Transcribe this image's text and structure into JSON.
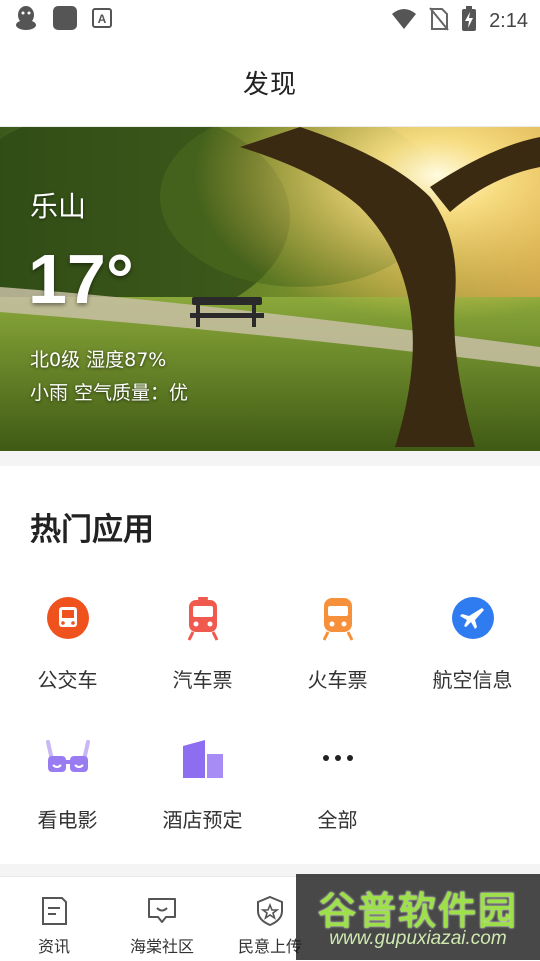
{
  "status_bar": {
    "time": "2:14",
    "left_icons": [
      "qq-penguin-icon",
      "app-square-icon",
      "a-badge-icon"
    ],
    "right_icons": [
      "wifi-icon",
      "no-sim-icon",
      "battery-charging-icon"
    ]
  },
  "header": {
    "title": "发现"
  },
  "weather": {
    "city": "乐山",
    "temperature": "17°",
    "wind_humidity": "北0级 湿度87%",
    "condition_air": "小雨 空气质量：优"
  },
  "hot_apps": {
    "title": "热门应用",
    "items": [
      {
        "label": "公交车",
        "icon": "bus-icon",
        "color": "#f0521e"
      },
      {
        "label": "汽车票",
        "icon": "coach-ticket-icon",
        "color": "#f05a4e"
      },
      {
        "label": "火车票",
        "icon": "train-ticket-icon",
        "color": "#f7903a"
      },
      {
        "label": "航空信息",
        "icon": "airplane-icon",
        "color": "#2f7cf0"
      },
      {
        "label": "看电影",
        "icon": "3d-glasses-icon",
        "color": "#9a7cf2"
      },
      {
        "label": "酒店预定",
        "icon": "hotel-building-icon",
        "color": "#8e6ef0"
      },
      {
        "label": "全部",
        "icon": "more-dots-icon",
        "color": "#222222"
      }
    ]
  },
  "tab_bar": {
    "items": [
      {
        "label": "资讯",
        "icon": "news-doc-icon"
      },
      {
        "label": "海棠社区",
        "icon": "community-chat-icon"
      },
      {
        "label": "民意上传",
        "icon": "shield-star-icon"
      }
    ]
  },
  "watermark": {
    "title": "谷普软件园",
    "url": "www.gupuxiazai.com"
  }
}
